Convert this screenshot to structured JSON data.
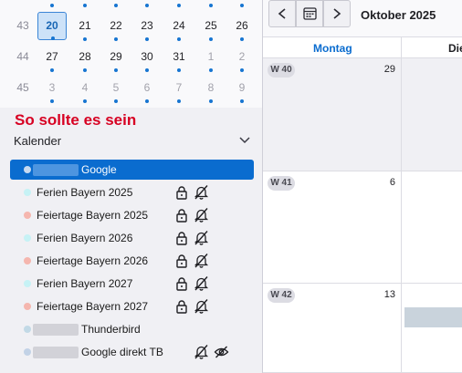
{
  "mini_calendar": {
    "top_dots_cols": [
      0,
      1,
      2,
      3,
      4,
      5,
      6
    ],
    "weeks": [
      {
        "week": "43",
        "days": [
          {
            "d": "20",
            "today": true
          },
          {
            "d": "21"
          },
          {
            "d": "22"
          },
          {
            "d": "23"
          },
          {
            "d": "24"
          },
          {
            "d": "25"
          },
          {
            "d": "26"
          }
        ]
      },
      {
        "week": "44",
        "days": [
          {
            "d": "27"
          },
          {
            "d": "28"
          },
          {
            "d": "29"
          },
          {
            "d": "30"
          },
          {
            "d": "31"
          },
          {
            "d": "1",
            "other": true
          },
          {
            "d": "2",
            "other": true
          }
        ]
      },
      {
        "week": "45",
        "days": [
          {
            "d": "3",
            "other": true
          },
          {
            "d": "4",
            "other": true
          },
          {
            "d": "5",
            "other": true
          },
          {
            "d": "6",
            "other": true
          },
          {
            "d": "7",
            "other": true
          },
          {
            "d": "8",
            "other": true
          },
          {
            "d": "9",
            "other": true
          }
        ]
      }
    ]
  },
  "annotation": "So sollte es sein",
  "calendars_header": "Kalender",
  "calendars": [
    {
      "label": "Google",
      "color": "#c8daf0",
      "selected": true,
      "blur": true,
      "lock": false,
      "bell": false,
      "eye": false
    },
    {
      "label": "Ferien Bayern 2025",
      "color": "#c6f2f5",
      "lock": true,
      "bell": true
    },
    {
      "label": "Feiertage Bayern 2025",
      "color": "#f5b6ae",
      "lock": true,
      "bell": true
    },
    {
      "label": "Ferien Bayern 2026",
      "color": "#c6f2f5",
      "lock": true,
      "bell": true
    },
    {
      "label": "Feiertage Bayern 2026",
      "color": "#f5b6ae",
      "lock": true,
      "bell": true
    },
    {
      "label": "Ferien Bayern 2027",
      "color": "#c6f2f5",
      "lock": true,
      "bell": true
    },
    {
      "label": "Feiertage Bayern 2027",
      "color": "#f5b6ae",
      "lock": true,
      "bell": true
    },
    {
      "label": "Thunderbird",
      "color": "#c2d9e6",
      "blur": true,
      "lock": false,
      "bell": false
    },
    {
      "label": "Google direkt TB",
      "color": "#c2d2e6",
      "blur": true,
      "lock": false,
      "bell": true,
      "eye": true
    }
  ],
  "toolbar": {
    "prev_icon": "chevron-left-icon",
    "today_icon": "calendar-today-icon",
    "next_icon": "chevron-right-icon",
    "month_label": "Oktober 2025"
  },
  "day_headers": [
    "Montag",
    "Die"
  ],
  "weeks_view": [
    {
      "badge": "W 40",
      "day": "29"
    },
    {
      "badge": "W 41",
      "day": "6"
    },
    {
      "badge": "W 42",
      "day": "13"
    }
  ],
  "colors": {
    "accent": "#0a6ccf",
    "annotation": "#d70022",
    "today_bg": "#cde2f8"
  }
}
